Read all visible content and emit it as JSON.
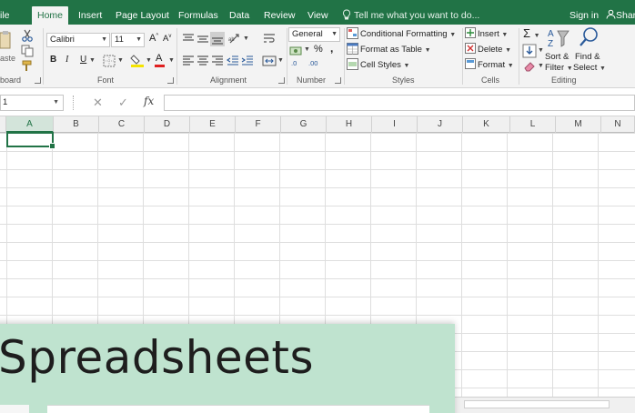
{
  "tabs": [
    {
      "label": "ile"
    },
    {
      "label": "Home"
    },
    {
      "label": "Insert"
    },
    {
      "label": "Page Layout"
    },
    {
      "label": "Formulas"
    },
    {
      "label": "Data"
    },
    {
      "label": "Review"
    },
    {
      "label": "View"
    }
  ],
  "tellme": "Tell me what you want to do...",
  "signin": "Sign in",
  "share": "Shar",
  "clipboard": {
    "paste_label": "aste",
    "group_label": "board"
  },
  "font": {
    "name": "Calibri",
    "size": "11",
    "group_label": "Font",
    "bold": "B",
    "italic": "I",
    "underline": "U",
    "grow": "A",
    "shrink": "A",
    "color_letter": "A"
  },
  "alignment": {
    "group_label": "Alignment"
  },
  "number": {
    "format": "General",
    "percent": "%",
    "comma": ",",
    "inc": ".0",
    "dec": ".00",
    "group_label": "Number"
  },
  "styles": {
    "conditional": "Conditional Formatting",
    "format_table": "Format as Table",
    "cell_styles": "Cell Styles",
    "group_label": "Styles"
  },
  "cells": {
    "insert": "Insert",
    "delete": "Delete",
    "format": "Format",
    "group_label": "Cells"
  },
  "editing": {
    "sort": "Sort &",
    "filter": "Filter",
    "find": "Find &",
    "select": "Select",
    "group_label": "Editing"
  },
  "formula_bar": {
    "namebox": "1",
    "fx": "fx",
    "cancel": "✕",
    "enter": "✓"
  },
  "columns": [
    "A",
    "B",
    "C",
    "D",
    "E",
    "F",
    "G",
    "H",
    "I",
    "J",
    "K",
    "L",
    "M",
    "N"
  ],
  "banner": {
    "title": "Spreadsheets"
  },
  "colors": {
    "accent": "#217346",
    "banner": "#bfe3cf"
  }
}
